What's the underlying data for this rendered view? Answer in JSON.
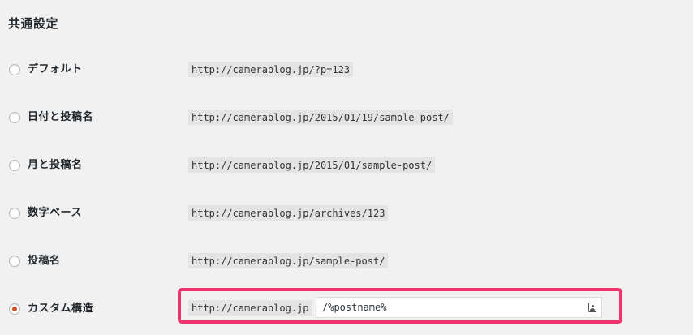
{
  "section": {
    "title": "共通設定"
  },
  "permalinks": {
    "options": [
      {
        "label": "デフォルト",
        "example": "http://camerablog.jp/?p=123",
        "selected": false
      },
      {
        "label": "日付と投稿名",
        "example": "http://camerablog.jp/2015/01/19/sample-post/",
        "selected": false
      },
      {
        "label": "月と投稿名",
        "example": "http://camerablog.jp/2015/01/sample-post/",
        "selected": false
      },
      {
        "label": "数字ベース",
        "example": "http://camerablog.jp/archives/123",
        "selected": false
      },
      {
        "label": "投稿名",
        "example": "http://camerablog.jp/sample-post/",
        "selected": false
      }
    ],
    "custom": {
      "label": "カスタム構造",
      "base": "http://camerablog.jp",
      "value": "/%postname%",
      "selected": true
    }
  },
  "colors": {
    "highlight_border": "#f0336e",
    "radio_selected": "#d54e21",
    "background": "#f1f1f1"
  },
  "icons": {
    "custom_input_icon": "contact-card-icon"
  }
}
